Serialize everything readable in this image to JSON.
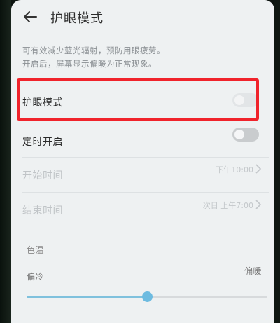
{
  "header": {
    "title": "护眼模式",
    "back_icon": "arrow-left-icon"
  },
  "description": {
    "line1": "可有效减少蓝光辐射，预防用眼疲劳。",
    "line2": "开启后，屏幕显示偏暖为正常现象。"
  },
  "settings": {
    "eye_mode": {
      "label": "护眼模式",
      "enabled": false
    },
    "schedule": {
      "label": "定时开启",
      "enabled": false
    },
    "start_time": {
      "label": "开始时间",
      "value": "下午10:00"
    },
    "end_time": {
      "label": "结束时间",
      "value": "次日 上午7:00"
    }
  },
  "color_temp": {
    "label": "色温",
    "cold_label": "偏冷",
    "warm_label": "偏暖",
    "level_fraction": 0.5
  },
  "colors": {
    "highlight": "#f0232b",
    "slider_accent": "#6dbbe0"
  }
}
